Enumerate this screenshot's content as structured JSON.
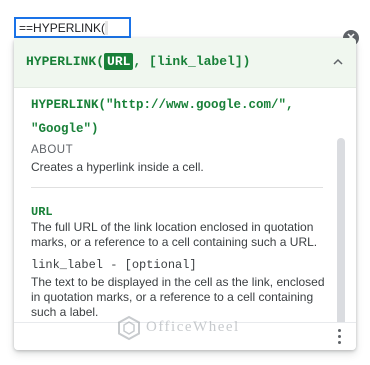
{
  "cell_input": {
    "prefix": "=",
    "text": "=HYPERLINK("
  },
  "close_icon": "close-icon",
  "help": {
    "signature": {
      "function_name": "HYPERLINK(",
      "active_param": "URL",
      "rest": ", [link_label])"
    },
    "example": [
      "HYPERLINK(\"http://www.google.com/\",",
      "\"Google\")"
    ],
    "about_label": "ABOUT",
    "about_text": "Creates a hyperlink inside a cell.",
    "params": [
      {
        "name": "URL",
        "description": "The full URL of the link location enclosed in quotation marks, or a reference to a cell containing such a URL."
      },
      {
        "name": "link_label - [optional]",
        "description": "The text to be displayed in the cell as the link, enclosed in quotation marks, or a reference to a cell containing such a label."
      }
    ]
  },
  "watermark": "OfficeWheel",
  "colors": {
    "accent": "#188038",
    "header_bg": "#f0f7ef",
    "cell_border": "#1a73e8"
  }
}
